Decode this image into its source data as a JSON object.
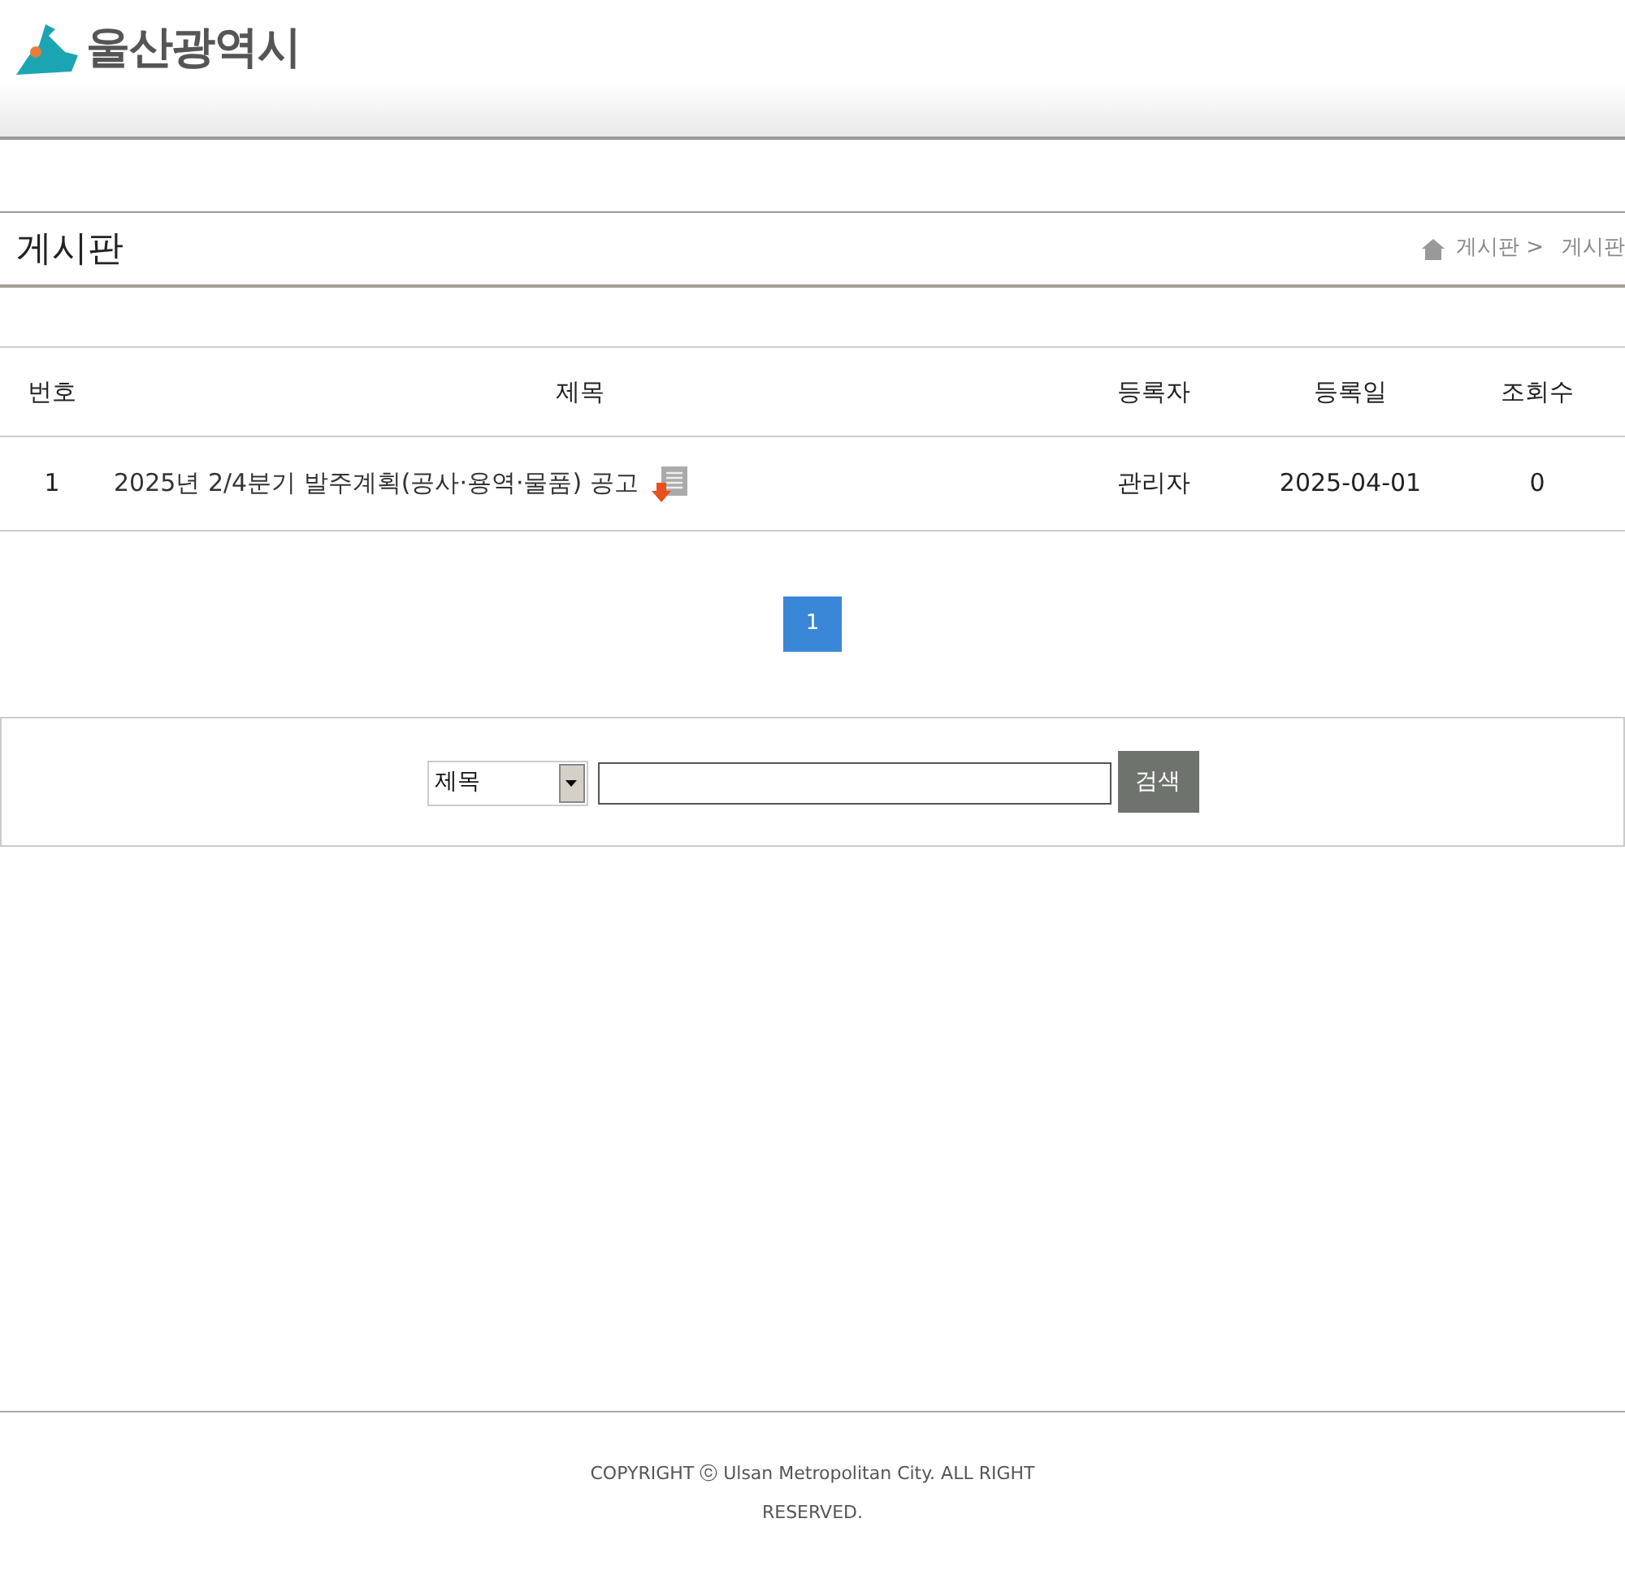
{
  "header": {
    "logo_text": "울산광역시"
  },
  "page_title": "게시판",
  "breadcrumb": [
    "게시판 >",
    "게시판"
  ],
  "table": {
    "columns": [
      "번호",
      "제목",
      "등록자",
      "등록일",
      "조회수"
    ],
    "rows": [
      {
        "number": "1",
        "title": "2025년 2/4분기 발주계획(공사·용역·물품) 공고",
        "has_attachment": true,
        "author": "관리자",
        "date": "2025-04-01",
        "views": "0"
      }
    ]
  },
  "pagination": [
    {
      "label": "1",
      "selected": true
    }
  ],
  "search": {
    "select_value": "제목",
    "button": "검색"
  },
  "footer": "COPYRIGHT ⓒ Ulsan Metropolitan City. ALL RIGHT RESERVED."
}
